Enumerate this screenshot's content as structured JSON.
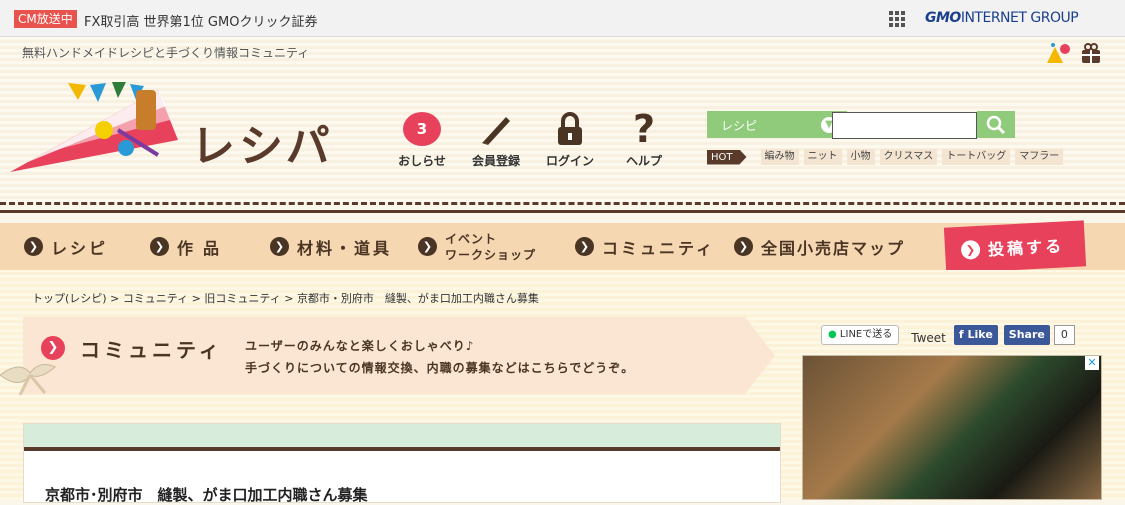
{
  "gmo_bar": {
    "cm_badge": "CM放送中",
    "ad_text": "FX取引高 世界第1位 GMOクリック証券",
    "group_logo_bold": "GMO",
    "group_logo_rest": "INTERNET GROUP"
  },
  "header": {
    "tagline": "無料ハンドメイドレシピと手づくり情報コミュニティ",
    "logo_text": "レシパ",
    "nav_icons": [
      {
        "label": "おしらせ",
        "badge": "3"
      },
      {
        "label": "会員登録"
      },
      {
        "label": "ログイン"
      },
      {
        "label": "ヘルプ",
        "symbol": "?"
      }
    ],
    "search": {
      "selected": "レシピ",
      "placeholder": ""
    },
    "hot": {
      "label": "HOT",
      "tags": [
        "編み物",
        "ニット",
        "小物",
        "クリスマス",
        "トートバッグ",
        "マフラー"
      ]
    }
  },
  "main_nav": {
    "items": [
      "レシピ",
      "作品",
      "材料・道具",
      "コミュニティ",
      "全国小売店マップ"
    ],
    "event_line1": "イベント",
    "event_line2": "ワークショップ",
    "post_label": "投稿する"
  },
  "breadcrumb": {
    "items": [
      "トップ(レシピ)",
      "コミュニティ",
      "旧コミュニティ",
      "京都市・別府市　縫製、がま口加工内職さん募集"
    ],
    "separator": ">"
  },
  "community": {
    "title": "コミュニティ",
    "desc_line1": "ユーザーのみんなと楽しくおしゃべり♪",
    "desc_line2": "手づくりについての情報交換、内職の募集などはこちらでどうぞ。"
  },
  "share": {
    "line_label": "LINEで送る",
    "tweet_label": "Tweet",
    "fb_like": "Like",
    "fb_share": "Share",
    "fb_count": "0"
  },
  "article": {
    "title": "京都市･別府市　縫製、がま口加工内職さん募集"
  },
  "colors": {
    "accent": "#e8415b",
    "brown": "#5a3a2a",
    "green": "#8fcb7a"
  }
}
